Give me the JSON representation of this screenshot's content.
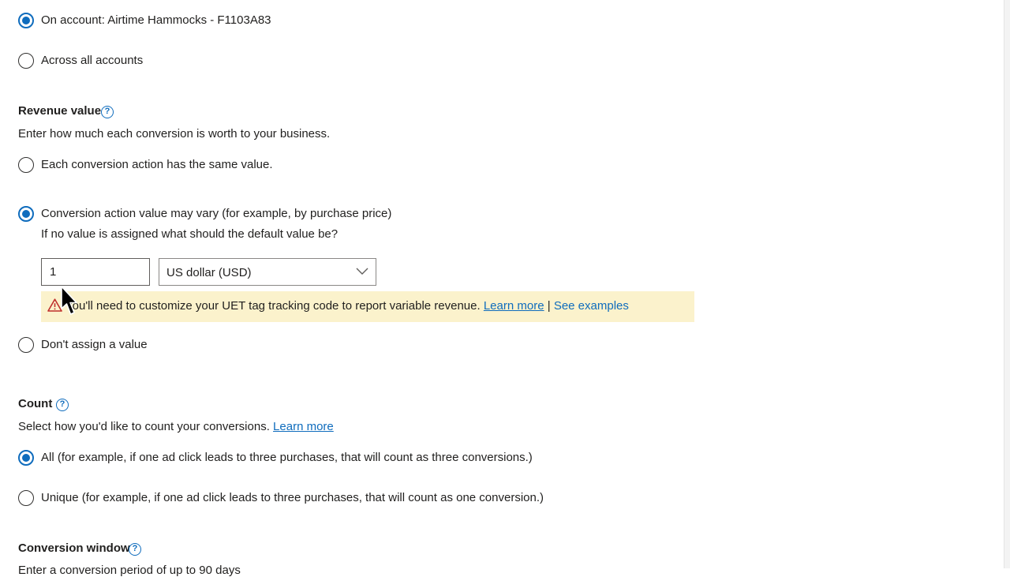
{
  "scope": {
    "on_account_label": "On account: Airtime Hammocks - F1103A83",
    "across_accounts_label": "Across all accounts",
    "selected": "on_account"
  },
  "revenue": {
    "heading": "Revenue value",
    "help_icon": "question-circle-icon",
    "description": "Enter how much each conversion is worth to your business.",
    "option_same": "Each conversion action has the same value.",
    "option_vary": "Conversion action value may vary (for example, by purchase price)",
    "default_prompt": "If no value is assigned what should the default value be?",
    "default_value": "1",
    "currency": "US dollar (USD)",
    "warning_icon": "warning-triangle-icon",
    "warning_text": "You'll need to customize your UET tag tracking code to report variable revenue.",
    "learn_more": "Learn more",
    "separator": "|",
    "see_examples": "See examples",
    "option_none": "Don't assign a value",
    "selected": "vary"
  },
  "count": {
    "heading": "Count",
    "help_icon": "question-circle-icon",
    "description": "Select how you'd like to count your conversions.",
    "learn_more": "Learn more",
    "option_all": "All (for example, if one ad click leads to three purchases, that will count as three conversions.)",
    "option_unique": "Unique (for example, if one ad click leads to three purchases, that will count as one conversion.)",
    "selected": "all"
  },
  "conversion_window": {
    "heading": "Conversion window",
    "help_icon": "question-circle-icon",
    "description_partial": "Enter a conversion period of up to 90 days"
  },
  "colors": {
    "accent": "#0f6cbd",
    "warning_bg": "#fbf2cc",
    "warning_icon": "#c0302d"
  }
}
